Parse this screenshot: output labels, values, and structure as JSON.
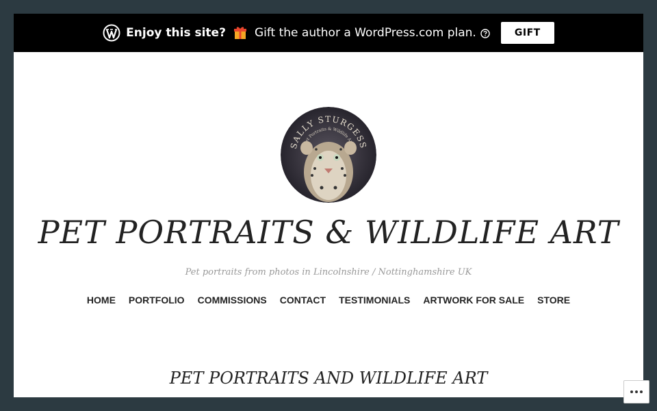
{
  "banner": {
    "enjoy_text": "Enjoy this site?",
    "gift_text": "Gift the author a WordPress.com plan.",
    "gift_button_label": "GIFT",
    "icons": [
      "wordpress-icon",
      "gift-emoji-icon",
      "help-icon"
    ]
  },
  "site": {
    "title": "PET PORTRAITS & WILDLIFE ART",
    "tagline": "Pet portraits from photos in Lincolnshire / Nottinghamshire UK",
    "logo_text": "SALLY STURGESS",
    "logo_subtext": "Pet Portraits & Wildlife Art"
  },
  "nav": {
    "items": [
      {
        "label": "HOME"
      },
      {
        "label": "PORTFOLIO"
      },
      {
        "label": "COMMISSIONS"
      },
      {
        "label": "CONTACT"
      },
      {
        "label": "TESTIMONIALS"
      },
      {
        "label": "ARTWORK FOR SALE"
      },
      {
        "label": "STORE"
      }
    ]
  },
  "page": {
    "heading": "PET PORTRAITS AND WILDLIFE ART"
  },
  "colors": {
    "page_background": "#2c3a41",
    "banner_background": "#000000",
    "content_background": "#ffffff",
    "text": "#222222",
    "tagline": "#999999"
  }
}
